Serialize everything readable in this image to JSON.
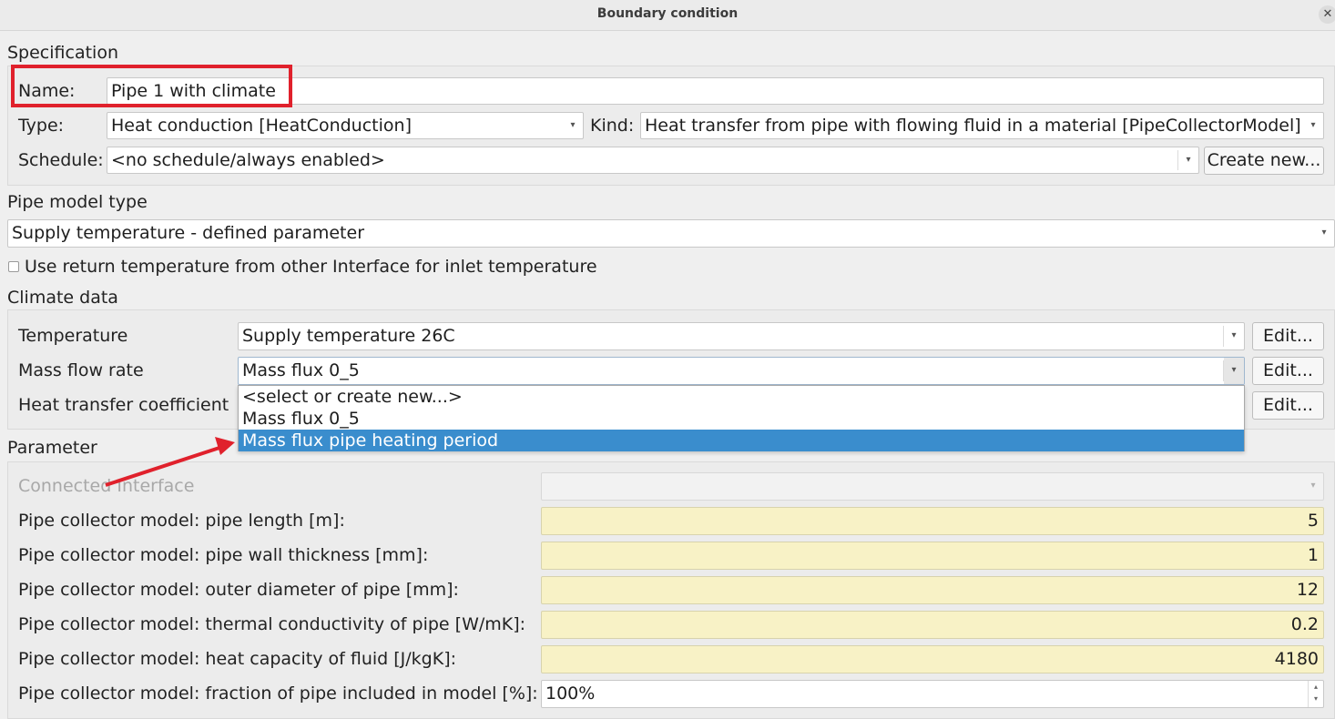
{
  "window": {
    "title": "Boundary condition",
    "close_glyph": "✕"
  },
  "specification": {
    "heading": "Specification",
    "name_label": "Name:",
    "name_value": "Pipe 1 with climate",
    "type_label": "Type:",
    "type_value": "Heat conduction [HeatConduction]",
    "kind_label": "Kind:",
    "kind_value": "Heat transfer from pipe with flowing fluid in a material [PipeCollectorModel]",
    "schedule_label": "Schedule:",
    "schedule_value": "<no schedule/always enabled>",
    "create_new_label": "Create new..."
  },
  "pipe_model": {
    "heading": "Pipe model type",
    "value": "Supply temperature - defined parameter",
    "checkbox_label": "Use return temperature from other Interface for inlet temperature",
    "checkbox_checked": false
  },
  "climate": {
    "heading": "Climate data",
    "temperature_label": "Temperature",
    "temperature_value": "Supply temperature 26C",
    "mass_flow_label": "Mass flow rate",
    "mass_flow_value": "Mass flux 0_5",
    "htc_label": "Heat transfer coefficient",
    "edit_label": "Edit...",
    "dropdown_options": [
      "<select or create new...>",
      "Mass flux 0_5",
      "Mass flux pipe heating period"
    ],
    "dropdown_highlighted_index": 2
  },
  "parameter": {
    "heading": "Parameter",
    "connected_interface_label": "Connected Interface",
    "rows": [
      {
        "label": "Pipe collector model: pipe length [m]:",
        "value": "5"
      },
      {
        "label": "Pipe collector model: pipe wall thickness [mm]:",
        "value": "1"
      },
      {
        "label": "Pipe collector model: outer diameter of pipe [mm]:",
        "value": "12"
      },
      {
        "label": "Pipe collector model: thermal conductivity of pipe [W/mK]:",
        "value": "0.2"
      },
      {
        "label": "Pipe collector model: heat capacity of fluid [J/kgK]:",
        "value": "4180"
      }
    ],
    "fraction_label": "Pipe collector model: fraction of pipe included in model [%]:",
    "fraction_value": "100%"
  },
  "colors": {
    "highlight": "#3a8dcd",
    "annotation_red": "#e0212c",
    "param_yellow": "#f8f2c6"
  },
  "icons": {
    "combo_arrow": "▾",
    "spin_up": "▴",
    "spin_down": "▾"
  }
}
